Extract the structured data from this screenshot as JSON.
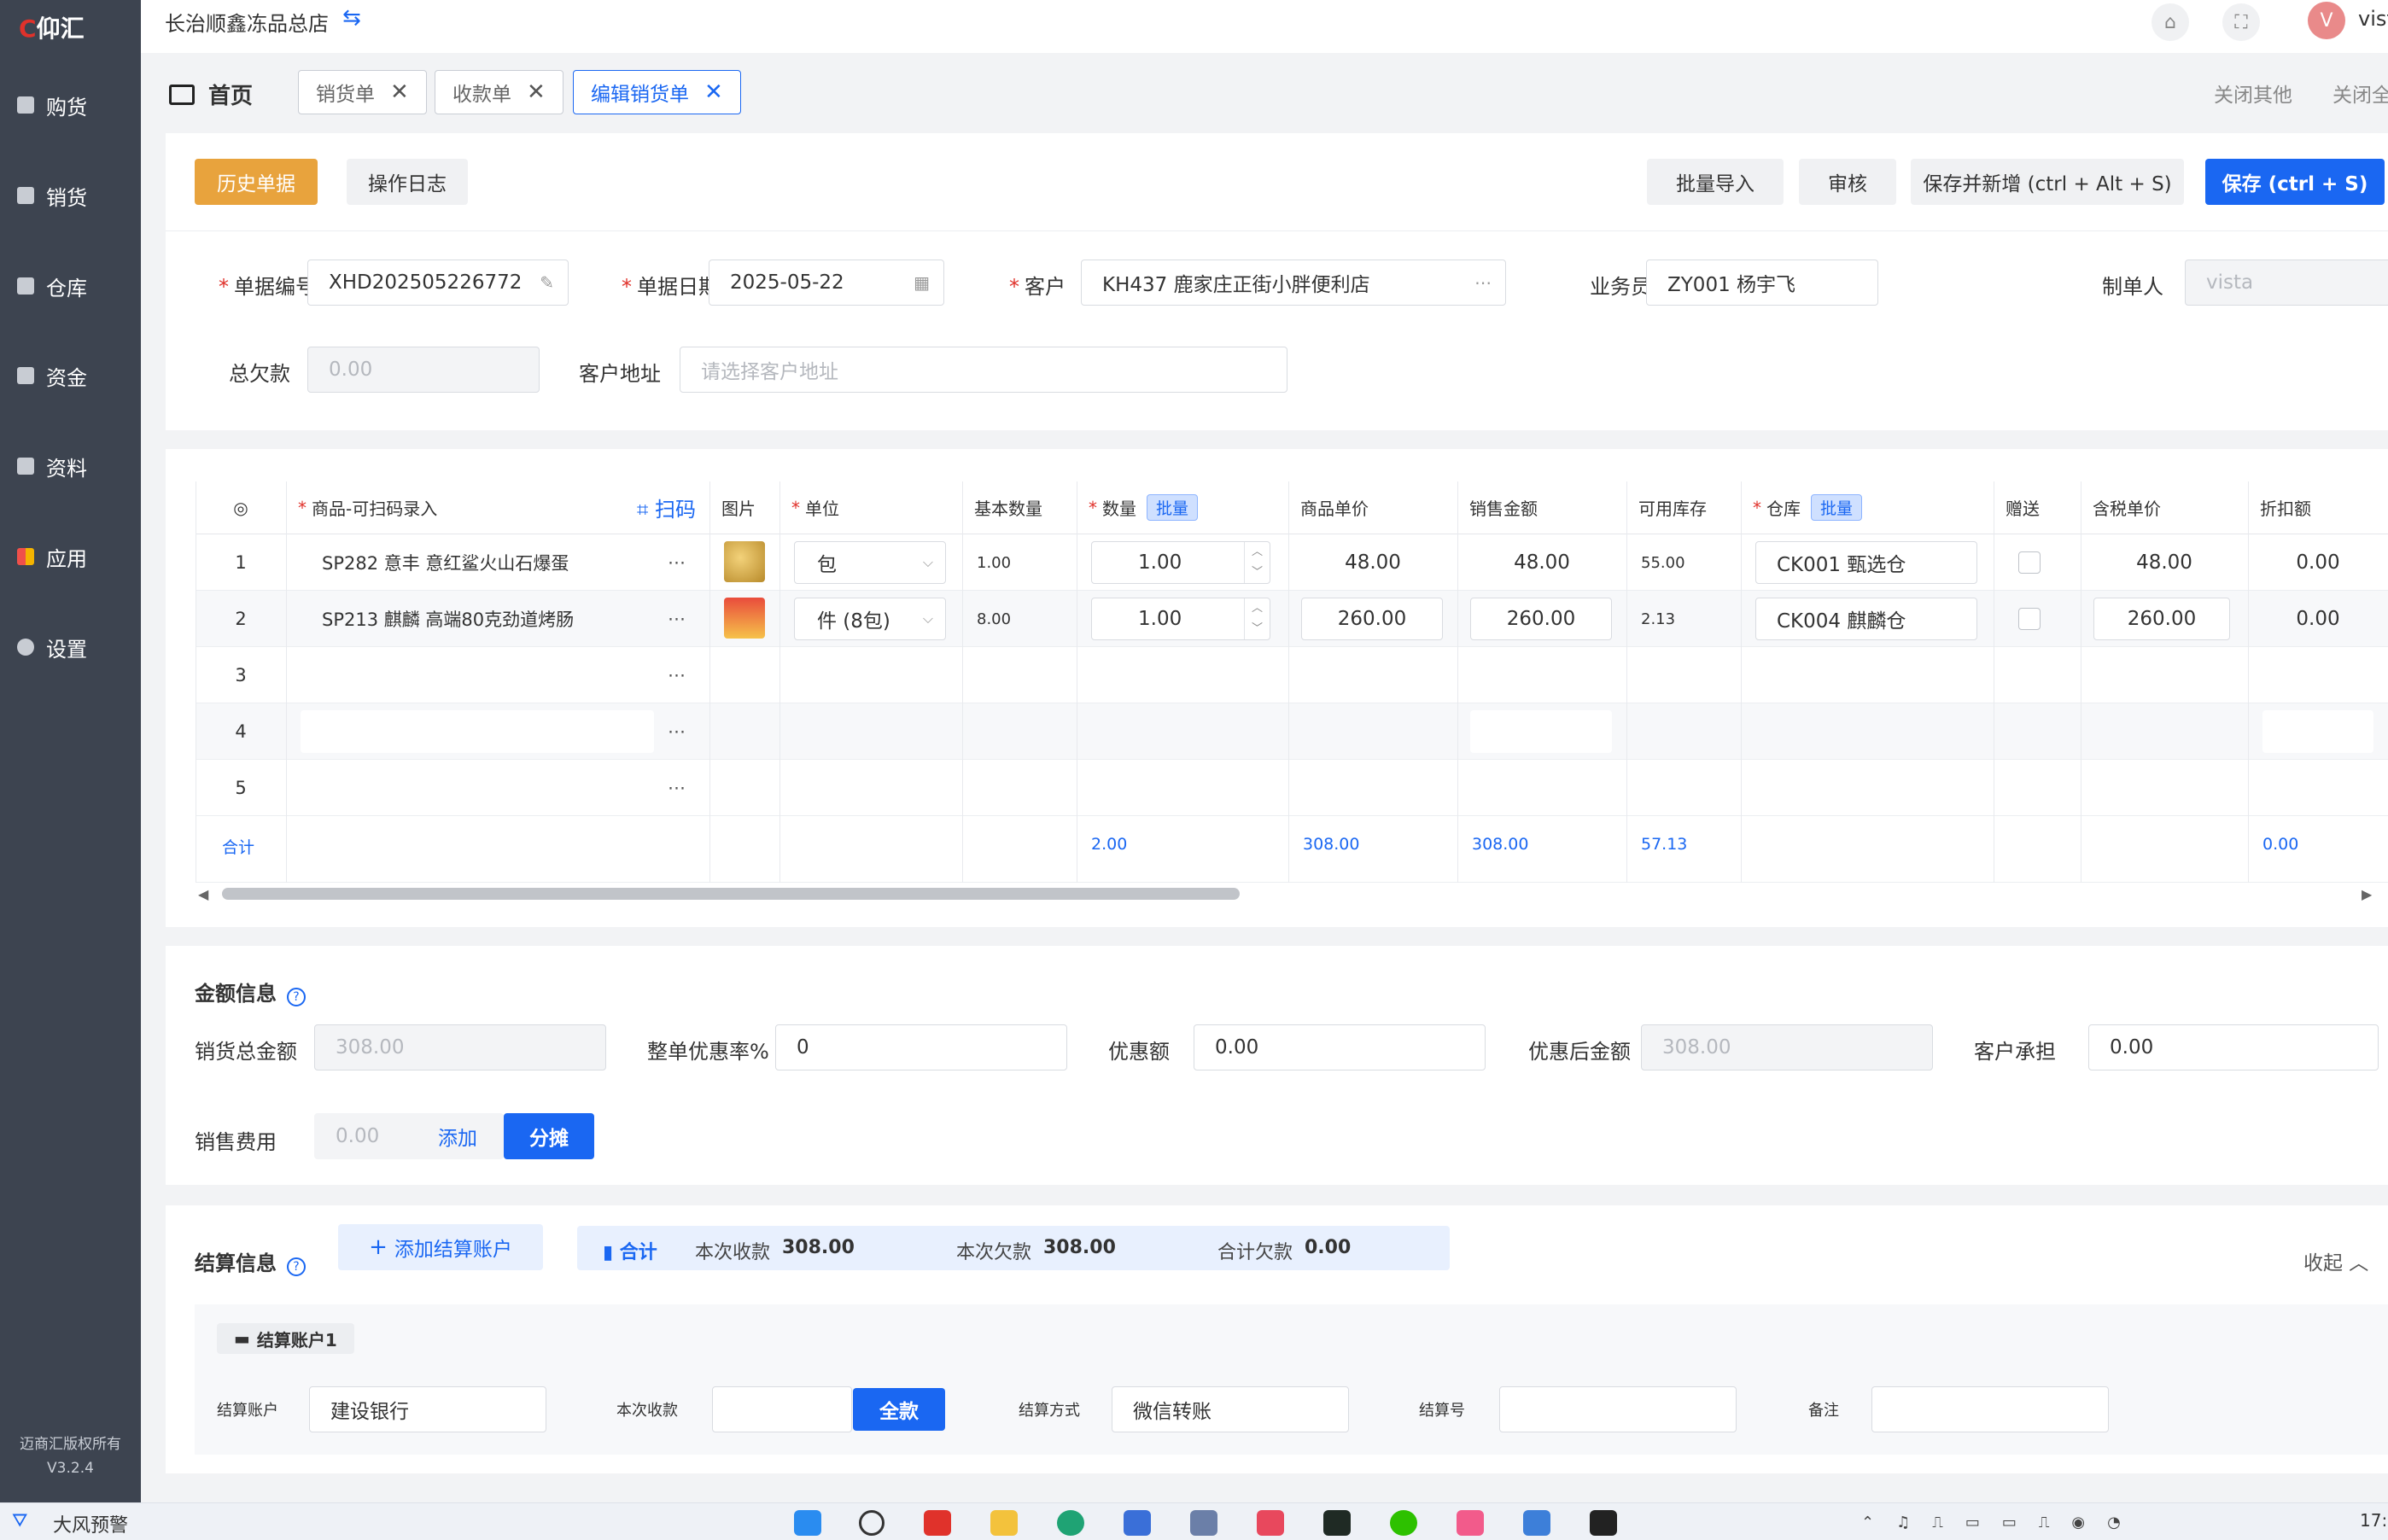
{
  "app": {
    "logo": "仰汇",
    "store_name": "长治顺鑫冻品总店",
    "user_name": "vista",
    "user_initial": "V",
    "copyright": "迈商汇版权所有",
    "version": "V3.2.4"
  },
  "sidebar": {
    "items": [
      {
        "label": "购货",
        "icon": "purchase-icon"
      },
      {
        "label": "销货",
        "icon": "sales-icon"
      },
      {
        "label": "仓库",
        "icon": "warehouse-icon"
      },
      {
        "label": "资金",
        "icon": "funds-icon"
      },
      {
        "label": "资料",
        "icon": "data-icon"
      },
      {
        "label": "应用",
        "icon": "apps-icon"
      },
      {
        "label": "设置",
        "icon": "settings-icon"
      }
    ]
  },
  "tabs": {
    "home": "首页",
    "items": [
      "销货单",
      "收款单",
      "编辑销货单"
    ],
    "close_others": "关闭其他",
    "close_all": "关闭全"
  },
  "toolbar": {
    "history": "历史单据",
    "log": "操作日志",
    "batch_import": "批量导入",
    "audit": "审核",
    "save_new": "保存并新增 (ctrl + Alt + S)",
    "save": "保存 (ctrl + S)"
  },
  "form": {
    "doc_no_label": "单据编号",
    "doc_no": "XHD202505226772",
    "date_label": "单据日期",
    "date": "2025-05-22",
    "customer_label": "客户",
    "customer": "KH437 鹿家庄正街小胖便利店",
    "salesman_label": "业务员",
    "salesman": "ZY001 杨宇飞",
    "maker_label": "制单人",
    "maker": "vista",
    "debt_label": "总欠款",
    "debt": "0.00",
    "address_label": "客户地址",
    "address_placeholder": "请选择客户地址"
  },
  "table": {
    "headers": {
      "product": "商品-可扫码录入",
      "scan": "扫码",
      "image": "图片",
      "unit": "单位",
      "base_qty": "基本数量",
      "qty": "数量",
      "batch": "批量",
      "unit_price": "商品单价",
      "amount": "销售金额",
      "stock": "可用库存",
      "warehouse": "仓库",
      "gift": "赠送",
      "tax_price": "含税单价",
      "discount": "折扣额"
    },
    "rows": [
      {
        "no": "1",
        "product": "SP282 意丰 意红鲨火山石爆蛋",
        "unit": "包",
        "base_qty": "1.00",
        "qty": "1.00",
        "unit_price": "48.00",
        "amount": "48.00",
        "stock": "55.00",
        "warehouse": "CK001 甄选仓",
        "tax_price": "48.00",
        "discount": "0.00"
      },
      {
        "no": "2",
        "product": "SP213 麒麟 高端80克劲道烤肠",
        "unit": "件 (8包)",
        "base_qty": "8.00",
        "qty": "1.00",
        "unit_price": "260.00",
        "amount": "260.00",
        "stock": "2.13",
        "warehouse": "CK004 麒麟仓",
        "tax_price": "260.00",
        "discount": "0.00"
      },
      {
        "no": "3"
      },
      {
        "no": "4"
      },
      {
        "no": "5"
      }
    ],
    "total": {
      "label": "合计",
      "qty": "2.00",
      "unit_price": "308.00",
      "amount": "308.00",
      "stock": "57.13",
      "discount": "0.00"
    }
  },
  "amount_info": {
    "title": "金额信息",
    "total_label": "销货总金额",
    "total": "308.00",
    "rate_label": "整单优惠率%",
    "rate": "0",
    "discount_label": "优惠额",
    "discount": "0.00",
    "after_label": "优惠后金额",
    "after": "308.00",
    "customer_bear_label": "客户承担",
    "customer_bear": "0.00",
    "fee_label": "销售费用",
    "fee": "0.00",
    "add": "添加",
    "split": "分摊"
  },
  "settle": {
    "title": "结算信息",
    "add_account": "添加结算账户",
    "sum_label": "合计",
    "received_label": "本次收款",
    "received": "308.00",
    "owed_label": "本次欠款",
    "owed": "308.00",
    "total_owed_label": "合计欠款",
    "total_owed": "0.00",
    "collapse": "收起",
    "account_title": "结算账户1",
    "account_label": "结算账户",
    "account": "建设银行",
    "receive_label": "本次收款",
    "full": "全款",
    "method_label": "结算方式",
    "method": "微信转账",
    "no_label": "结算号",
    "remark_label": "备注"
  },
  "taskbar": {
    "weather": "大风预警",
    "time": "17:"
  }
}
